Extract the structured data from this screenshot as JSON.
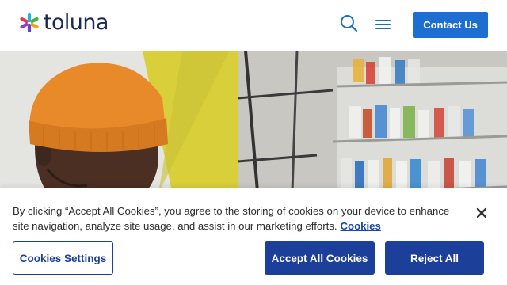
{
  "header": {
    "logo_text": "toluna",
    "search_icon": "search-icon",
    "menu_icon": "hamburger-menu-icon",
    "contact_label": "Contact Us"
  },
  "hero": {
    "image": "photo-man-in-orange-beanie-in-store-aisle"
  },
  "cookie_banner": {
    "message": "By clicking “Accept All Cookies”, you agree to the storing of cookies on your device to enhance site navigation, analyze site usage, and assist in our marketing efforts.",
    "policy_link": "Cookies",
    "close_icon": "close-icon",
    "settings_label": "Cookies Settings",
    "accept_label": "Accept All Cookies",
    "reject_label": "Reject All"
  },
  "colors": {
    "brand_navy": "#1b2a4e",
    "contact_blue": "#1c6fd0",
    "cookie_button_blue": "#1c3f9a",
    "accent_yellow": "#d8cf3a",
    "beanie_orange": "#e8892a"
  }
}
